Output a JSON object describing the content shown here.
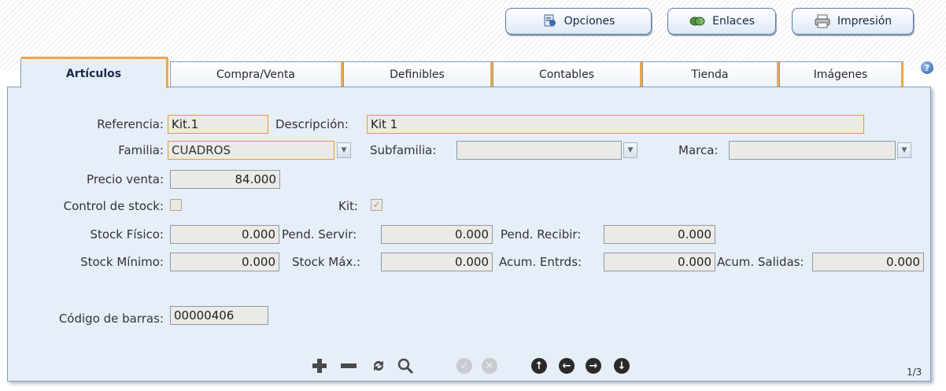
{
  "toolbar": {
    "options_label": "Opciones",
    "links_label": "Enlaces",
    "print_label": "Impresión"
  },
  "tabs": [
    {
      "label": "Artículos"
    },
    {
      "label": "Compra/Venta"
    },
    {
      "label": "Definibles"
    },
    {
      "label": "Contables"
    },
    {
      "label": "Tienda"
    },
    {
      "label": "Imágenes"
    }
  ],
  "form": {
    "referencia": {
      "label": "Referencia:",
      "value": "Kit.1"
    },
    "descripcion": {
      "label": "Descripción:",
      "value": "Kit 1"
    },
    "familia": {
      "label": "Familia:",
      "value": "CUADROS"
    },
    "subfamilia": {
      "label": "Subfamilia:",
      "value": ""
    },
    "marca": {
      "label": "Marca:",
      "value": ""
    },
    "precio_venta": {
      "label": "Precio venta:",
      "value": "84.000"
    },
    "control_stock": {
      "label": "Control de stock:",
      "checked": false
    },
    "kit": {
      "label": "Kit:",
      "checked": true
    },
    "stock_fisico": {
      "label": "Stock Físico:",
      "value": "0.000"
    },
    "pend_servir": {
      "label": "Pend. Servir:",
      "value": "0.000"
    },
    "pend_recibir": {
      "label": "Pend. Recibir:",
      "value": "0.000"
    },
    "stock_minimo": {
      "label": "Stock Mínimo:",
      "value": "0.000"
    },
    "stock_max": {
      "label": "Stock Máx.:",
      "value": "0.000"
    },
    "acum_entrds": {
      "label": "Acum. Entrds:",
      "value": "0.000"
    },
    "acum_salidas": {
      "label": "Acum. Salidas:",
      "value": "0.000"
    },
    "codigo_barras": {
      "label": "Código de barras:",
      "value": "00000406"
    }
  },
  "pager": {
    "text": "1/3"
  },
  "help_icon": "question-icon",
  "icons": [
    "add-icon",
    "remove-icon",
    "refresh-icon",
    "search-icon",
    "confirm-icon",
    "cancel-icon",
    "first-icon",
    "previous-icon",
    "next-icon",
    "last-icon"
  ]
}
